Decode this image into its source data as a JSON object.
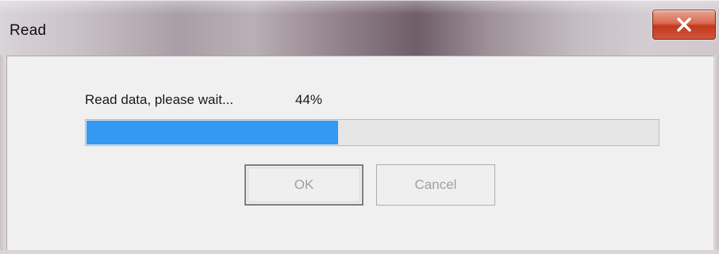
{
  "window": {
    "title": "Read",
    "close_icon": "close-icon"
  },
  "dialog": {
    "status_text": "Read data, please wait...",
    "percent_label": "44%",
    "progress_percent": 44,
    "progress_color": "#3399F3"
  },
  "buttons": {
    "ok_label": "OK",
    "cancel_label": "Cancel"
  }
}
